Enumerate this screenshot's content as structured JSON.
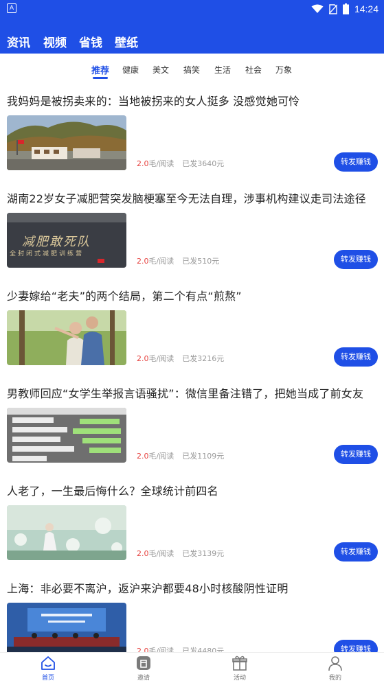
{
  "status_bar": {
    "notification_icon_text": "A",
    "time": "14:24",
    "icons": [
      "wifi-icon",
      "no-sim-icon",
      "battery-icon"
    ]
  },
  "top_nav": {
    "tabs": [
      "资讯",
      "视频",
      "省钱",
      "壁纸"
    ]
  },
  "sub_tabs": {
    "items": [
      "推荐",
      "健康",
      "美文",
      "搞笑",
      "生活",
      "社会",
      "万象"
    ],
    "active_index": 0
  },
  "articles": [
    {
      "title": "我妈妈是被拐卖来的：当地被拐来的女人挺多 没感觉她可怜",
      "price": "2.0",
      "price_unit": "毛/阅读",
      "paid": "已发3640元",
      "button": "转发赚钱",
      "thumb": "mountain-village-photo"
    },
    {
      "title": "湖南22岁女子减肥营突发脑梗塞至今无法自理，涉事机构建议走司法途径",
      "price": "2.0",
      "price_unit": "毛/阅读",
      "paid": "已发510元",
      "button": "转发赚钱",
      "thumb": "weight-loss-camp-sign-photo",
      "thumb_text": {
        "line1": "减肥敢死队",
        "line2": "全封闭式减肥训练营"
      }
    },
    {
      "title": "少妻嫁给“老夫”的两个结局，第二个有点“煎熬”",
      "price": "2.0",
      "price_unit": "毛/阅读",
      "paid": "已发3216元",
      "button": "转发赚钱",
      "thumb": "couple-outdoors-photo"
    },
    {
      "title": "男教师回应“女学生举报言语骚扰”：微信里备注错了，把她当成了前女友",
      "price": "2.0",
      "price_unit": "毛/阅读",
      "paid": "已发1109元",
      "button": "转发赚钱",
      "thumb": "chat-screenshot-photo"
    },
    {
      "title": "人老了，一生最后悔什么？全球统计前四名",
      "price": "2.0",
      "price_unit": "毛/阅读",
      "paid": "已发3139元",
      "button": "转发赚钱",
      "thumb": "girl-in-flower-field-photo"
    },
    {
      "title": "上海：非必要不离沪，返沪来沪都要48小时核酸阴性证明",
      "price": "2.0",
      "price_unit": "毛/阅读",
      "paid": "已发4480元",
      "button": "转发赚钱",
      "thumb": "press-conference-photo"
    }
  ],
  "bottom_nav": {
    "items": [
      {
        "label": "首页",
        "icon": "home-icon",
        "active": true
      },
      {
        "label": "邀请",
        "icon": "invite-icon",
        "active": false
      },
      {
        "label": "活动",
        "icon": "gift-icon",
        "active": false
      },
      {
        "label": "我的",
        "icon": "profile-icon",
        "active": false
      }
    ]
  },
  "colors": {
    "brand_blue": "#1f4fe6",
    "price_red": "#e64340",
    "meta_gray": "#999999"
  }
}
